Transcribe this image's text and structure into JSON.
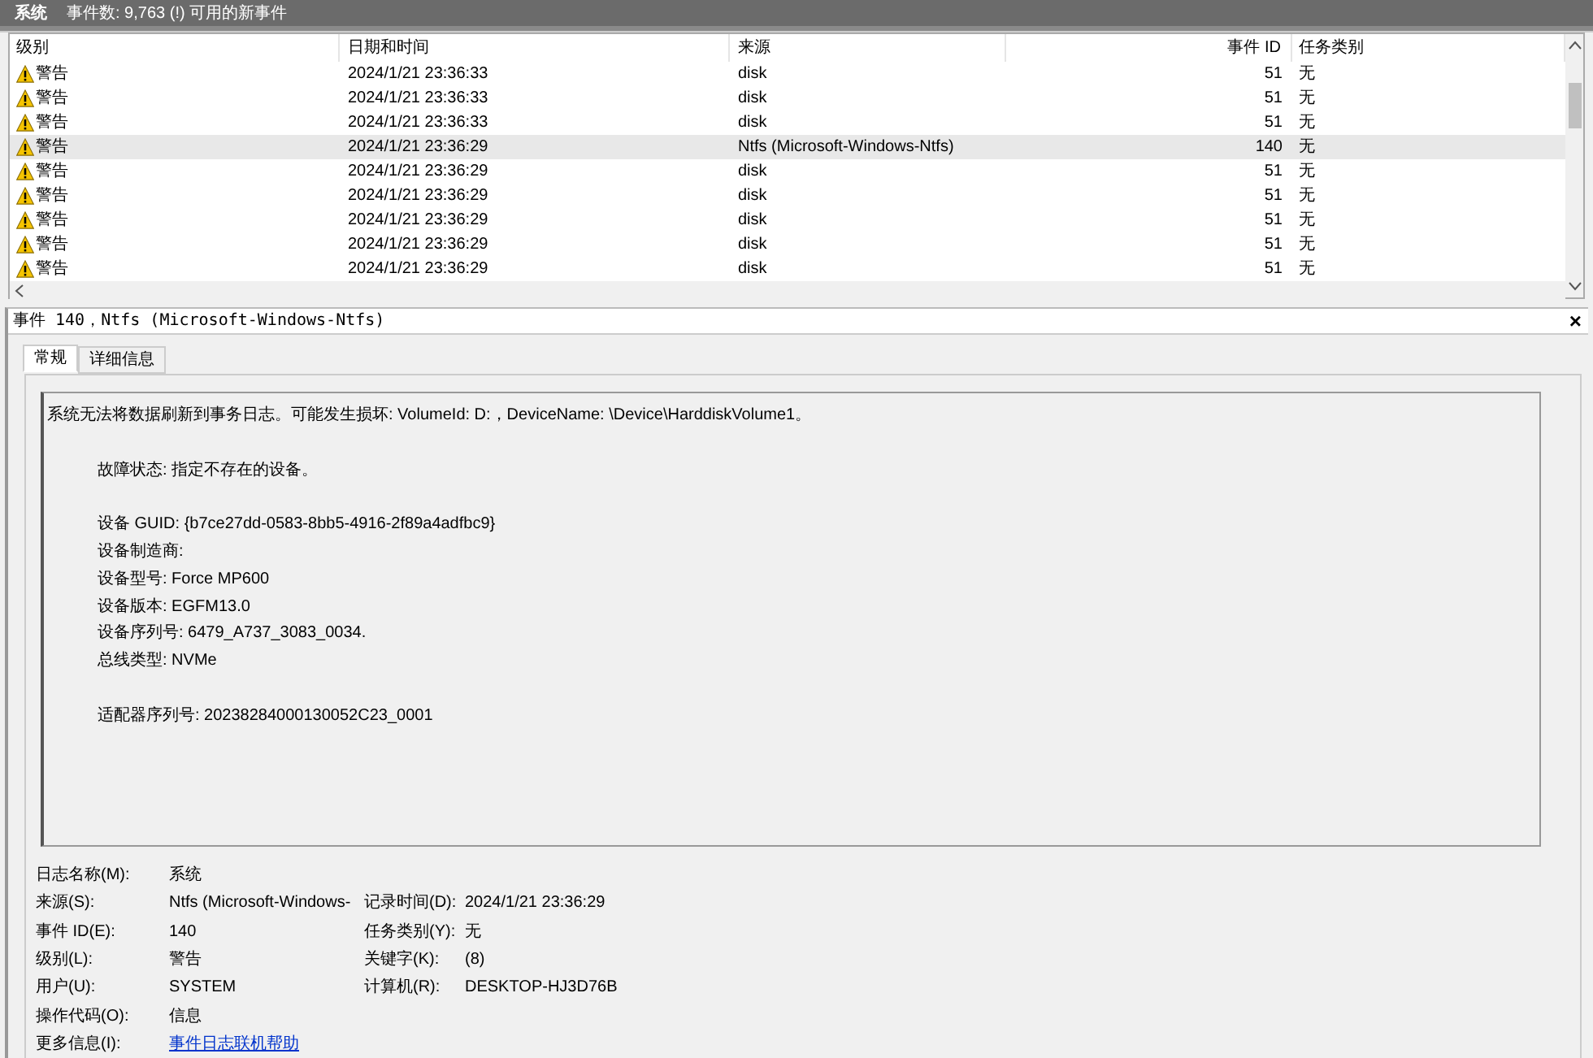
{
  "header": {
    "title": "系统",
    "summary": "事件数: 9,763 (!) 可用的新事件"
  },
  "table": {
    "columns": [
      "级别",
      "日期和时间",
      "来源",
      "事件 ID",
      "任务类别"
    ],
    "rows": [
      {
        "level": "警告",
        "kind": "warning",
        "datetime": "2024/1/21 23:36:33",
        "source": "disk",
        "event_id": "51",
        "task": "无",
        "selected": false
      },
      {
        "level": "警告",
        "kind": "warning",
        "datetime": "2024/1/21 23:36:33",
        "source": "disk",
        "event_id": "51",
        "task": "无",
        "selected": false
      },
      {
        "level": "警告",
        "kind": "warning",
        "datetime": "2024/1/21 23:36:33",
        "source": "disk",
        "event_id": "51",
        "task": "无",
        "selected": false
      },
      {
        "level": "警告",
        "kind": "warning",
        "datetime": "2024/1/21 23:36:29",
        "source": "Ntfs (Microsoft-Windows-Ntfs)",
        "event_id": "140",
        "task": "无",
        "selected": true
      },
      {
        "level": "警告",
        "kind": "warning",
        "datetime": "2024/1/21 23:36:29",
        "source": "disk",
        "event_id": "51",
        "task": "无",
        "selected": false
      },
      {
        "level": "警告",
        "kind": "warning",
        "datetime": "2024/1/21 23:36:29",
        "source": "disk",
        "event_id": "51",
        "task": "无",
        "selected": false
      },
      {
        "level": "警告",
        "kind": "warning",
        "datetime": "2024/1/21 23:36:29",
        "source": "disk",
        "event_id": "51",
        "task": "无",
        "selected": false
      },
      {
        "level": "警告",
        "kind": "warning",
        "datetime": "2024/1/21 23:36:29",
        "source": "disk",
        "event_id": "51",
        "task": "无",
        "selected": false
      },
      {
        "level": "警告",
        "kind": "warning",
        "datetime": "2024/1/21 23:36:29",
        "source": "disk",
        "event_id": "51",
        "task": "无",
        "selected": false
      }
    ]
  },
  "detail": {
    "title": "事件 140，Ntfs (Microsoft-Windows-Ntfs)",
    "tabs": [
      {
        "label": "常规",
        "selected": true
      },
      {
        "label": "详细信息",
        "selected": false
      }
    ],
    "description": [
      {
        "kind": "summary",
        "lines": [
          "系统无法将数据刷新到事务日志。可能发生损坏: VolumeId: D:，DeviceName: \\Device\\HarddiskVolume1。"
        ]
      },
      {
        "kind": "detail",
        "lines": [
          "故障状态: 指定不存在的设备。"
        ]
      },
      {
        "kind": "detail",
        "lines": [
          "设备 GUID: {b7ce27dd-0583-8bb5-4916-2f89a4adfbc9}",
          "设备制造商:",
          "设备型号: Force MP600",
          "设备版本: EGFM13.0",
          "设备序列号: 6479_A737_3083_0034.",
          "总线类型: NVMe"
        ]
      },
      {
        "kind": "detail",
        "lines": [
          "适配器序列号: 20238284000130052C23_0001"
        ]
      }
    ],
    "fields": [
      [
        {
          "label": "日志名称(M):",
          "value": "系统"
        }
      ],
      [
        {
          "label": "来源(S):",
          "value": "Ntfs (Microsoft-Windows-"
        },
        {
          "label": "记录时间(D):",
          "value": "2024/1/21 23:36:29"
        }
      ],
      [
        {
          "label": "事件 ID(E):",
          "value": "140"
        },
        {
          "label": "任务类别(Y):",
          "value": "无"
        }
      ],
      [
        {
          "label": "级别(L):",
          "value": "警告"
        },
        {
          "label": "关键字(K):",
          "value": "(8)"
        }
      ],
      [
        {
          "label": "用户(U):",
          "value": "SYSTEM"
        },
        {
          "label": "计算机(R):",
          "value": "DESKTOP-HJ3D76B"
        }
      ],
      [
        {
          "label": "操作代码(O):",
          "value": "信息"
        }
      ],
      [
        {
          "label": "更多信息(I):",
          "value": "事件日志联机帮助",
          "link": true
        }
      ]
    ],
    "close": "×"
  }
}
